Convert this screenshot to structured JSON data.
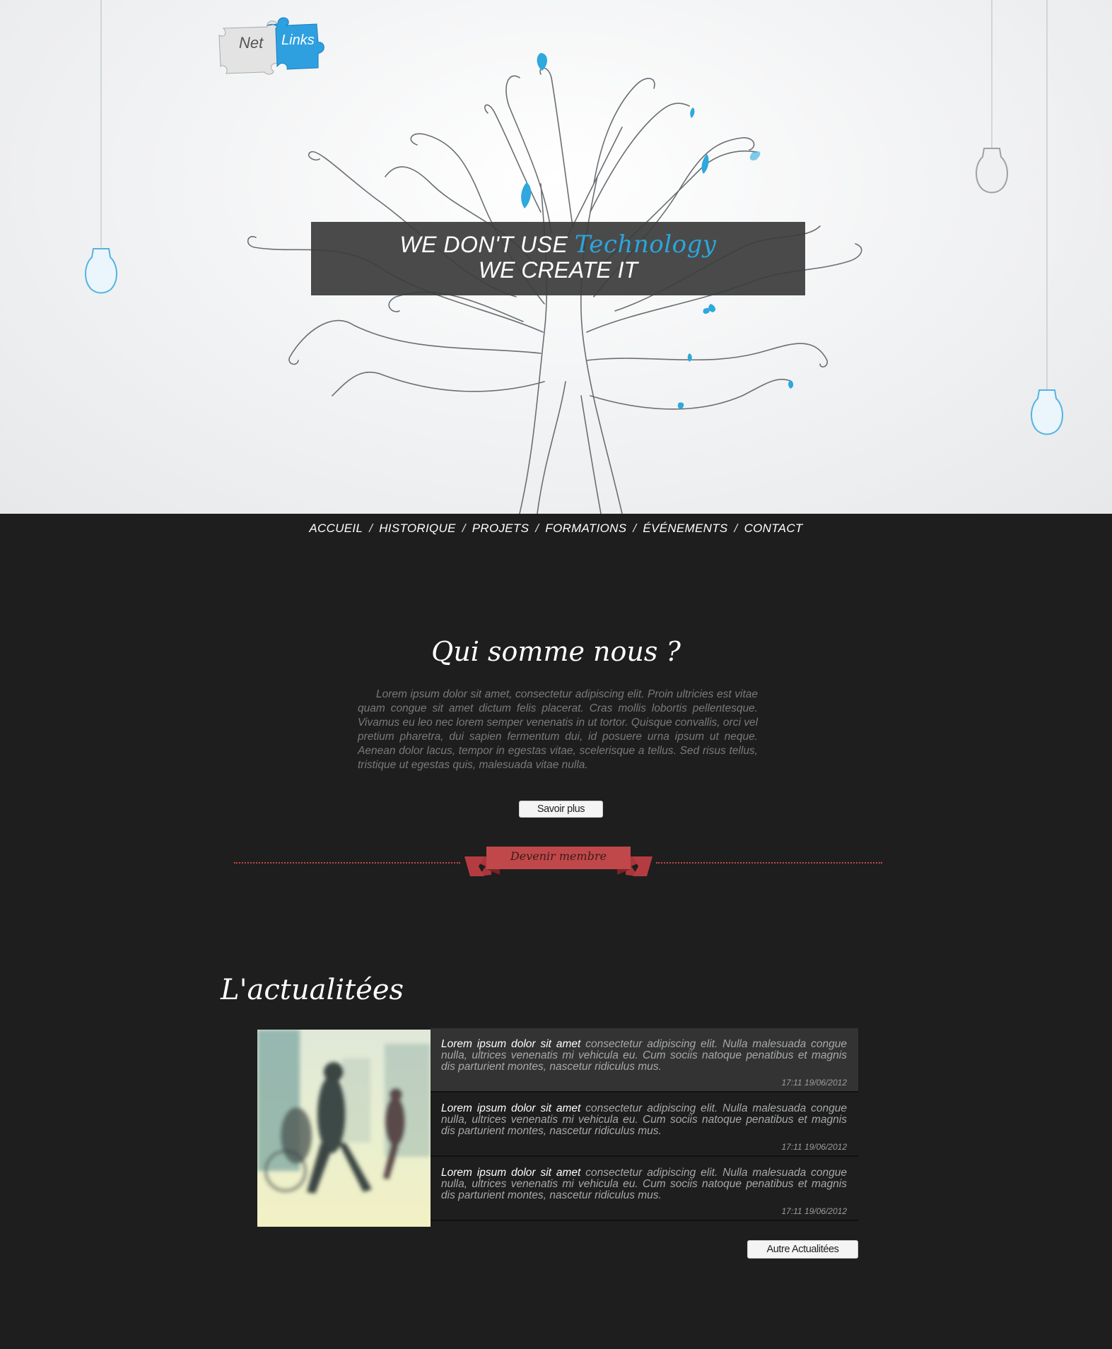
{
  "logo": {
    "part1": "Net",
    "part2": "Links"
  },
  "hero": {
    "line1_prefix": "WE DON'T USE",
    "line1_highlight": "Technology",
    "line2": "WE CREATE IT",
    "highlight_color": "#2aa6dd"
  },
  "nav": {
    "items": [
      "ACCUEIL",
      "HISTORIQUE",
      "PROJETS",
      "FORMATIONS",
      "ÉVÉNEMENTS",
      "CONTACT"
    ],
    "separator": "/"
  },
  "about": {
    "title": "Qui somme nous ?",
    "text": "Lorem ipsum dolor sit amet, consectetur adipiscing elit. Proin ultricies est vitae quam congue sit amet dictum felis placerat. Cras mollis lobortis pellentesque. Vivamus eu leo nec lorem semper venenatis in ut tortor. Quisque convallis, orci vel pretium pharetra, dui sapien fermentum dui, id posuere urna ipsum ut neque. Aenean dolor lacus, tempor in egestas vitae, scelerisque a tellus. Sed risus tellus, tristique ut egestas quis, malesuada vitae nulla.",
    "button": "Savoir plus"
  },
  "member_ribbon": {
    "label": "Devenir membre",
    "color": "#c0484a"
  },
  "news": {
    "title": "L'actualitées",
    "items": [
      {
        "lead": "Lorem ipsum dolor sit amet",
        "body": " consectetur adipiscing elit. Nulla malesuada congue nulla, ultrices venenatis mi vehicula eu. Cum sociis natoque penatibus et magnis dis parturient montes, nascetur ridiculus mus.",
        "date": "17:11 19/06/2012"
      },
      {
        "lead": "Lorem ipsum dolor sit amet",
        "body": " consectetur adipiscing elit. Nulla malesuada congue nulla, ultrices venenatis mi vehicula eu. Cum sociis natoque penatibus et magnis dis parturient montes, nascetur ridiculus mus.",
        "date": "17:11 19/06/2012"
      },
      {
        "lead": "Lorem ipsum dolor sit amet",
        "body": " consectetur adipiscing elit. Nulla malesuada congue nulla, ultrices venenatis mi vehicula eu. Cum sociis natoque penatibus et magnis dis parturient montes, nascetur ridiculus mus.",
        "date": "17:11 19/06/2012"
      }
    ],
    "more_button": "Autre Actualitées"
  }
}
